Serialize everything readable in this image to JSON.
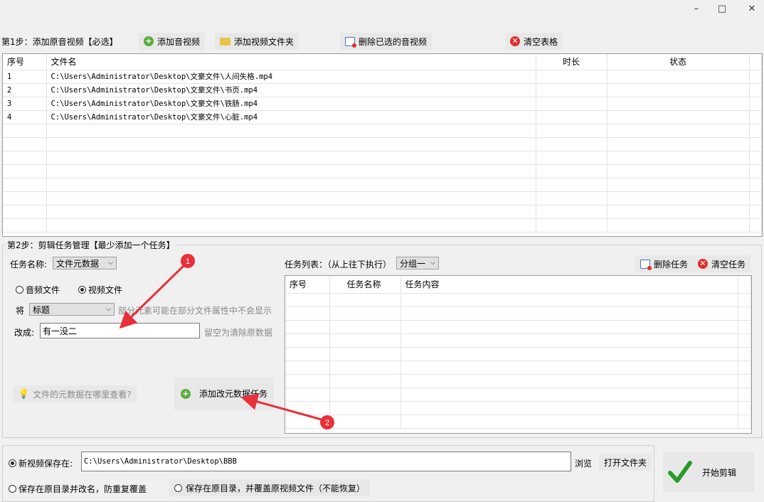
{
  "window": {
    "minimize_glyph": "–",
    "maximize_glyph": "□",
    "close_glyph": "✕"
  },
  "step1": {
    "label": "第1步：添加原音视频【必选】",
    "add_button": "添加音视频",
    "add_folder_button": "添加视频文件夹",
    "delete_selected_button": "删除已选的音视频",
    "clear_button": "清空表格"
  },
  "file_table": {
    "columns": [
      "序号",
      "文件名",
      "时长",
      "状态"
    ],
    "rows": [
      {
        "index": "1",
        "filename": "C:\\Users\\Administrator\\Desktop\\文豪文件\\人间失格.mp4",
        "duration": "",
        "status": ""
      },
      {
        "index": "2",
        "filename": "C:\\Users\\Administrator\\Desktop\\文豪文件\\书页.mp4",
        "duration": "",
        "status": ""
      },
      {
        "index": "3",
        "filename": "C:\\Users\\Administrator\\Desktop\\文豪文件\\铁肠.mp4",
        "duration": "",
        "status": ""
      },
      {
        "index": "4",
        "filename": "C:\\Users\\Administrator\\Desktop\\文豪文件\\心脏.mp4",
        "duration": "",
        "status": ""
      }
    ]
  },
  "step2": {
    "label": "第2步：剪辑任务管理【最少添加一个任务】",
    "task_name_label": "任务名称:",
    "task_name_value": "文件元数据",
    "audio_radio": "音频文件",
    "video_radio": "视频文件",
    "jiang_label": "将",
    "field_value": "标题",
    "field_hint": "部分元素可能在部分文件属性中不会显示",
    "change_label": "改成:",
    "change_value": "有一没二",
    "change_hint": "留空为清除原数据",
    "help_link": "文件的元数据在哪里查看?",
    "add_task_button": "添加改元数据任务",
    "task_list_label": "任务列表：（从上往下执行）",
    "group_value": "分组一",
    "delete_task_button": "删除任务",
    "clear_task_button": "清空任务",
    "task_columns": [
      "序号",
      "任务名称",
      "任务内容"
    ]
  },
  "annotations": {
    "marker1": "1",
    "marker2": "2",
    "color": "#e8303a"
  },
  "output": {
    "save_new_label": "新视频保存在:",
    "save_path": "C:\\Users\\Administrator\\Desktop\\BBB",
    "browse_button": "浏览",
    "open_folder_button": "打开文件夹",
    "save_rename_label": "保存在原目录并改名，防重复覆盖",
    "save_overwrite_label": "保存在原目录，并覆盖原视频文件（不能恢复）",
    "start_button": "开始剪辑"
  }
}
